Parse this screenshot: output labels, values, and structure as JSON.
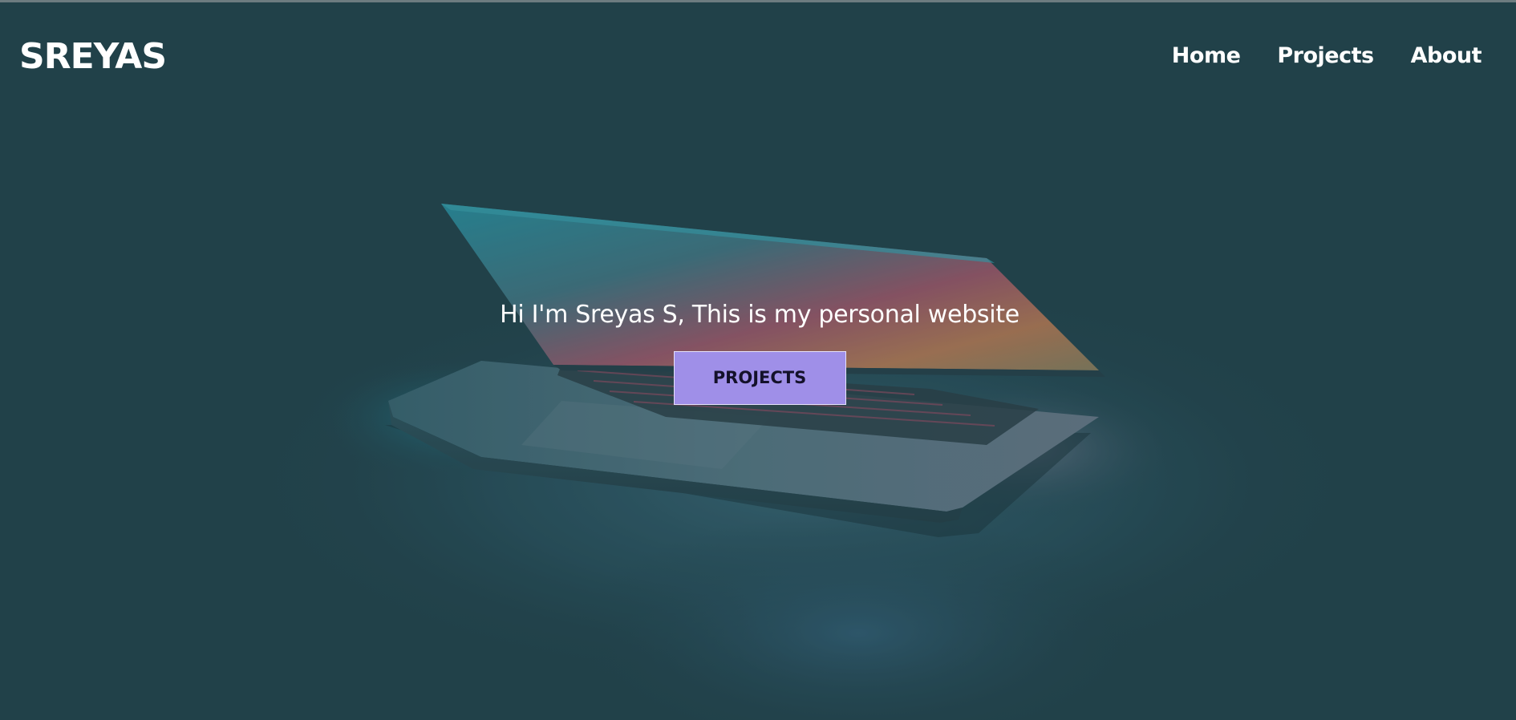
{
  "site": {
    "logo": "SREYAS"
  },
  "nav": {
    "items": [
      {
        "label": "Home"
      },
      {
        "label": "Projects"
      },
      {
        "label": "About"
      }
    ]
  },
  "hero": {
    "heading": "Hi I'm Sreyas S, This is my personal website",
    "button_label": "PROJECTS",
    "background_image": "laptop-dark-photo"
  },
  "colors": {
    "background": "#22434b",
    "text": "#ffffff",
    "button_bg": "#9f8fe8",
    "button_text": "#14112a"
  }
}
